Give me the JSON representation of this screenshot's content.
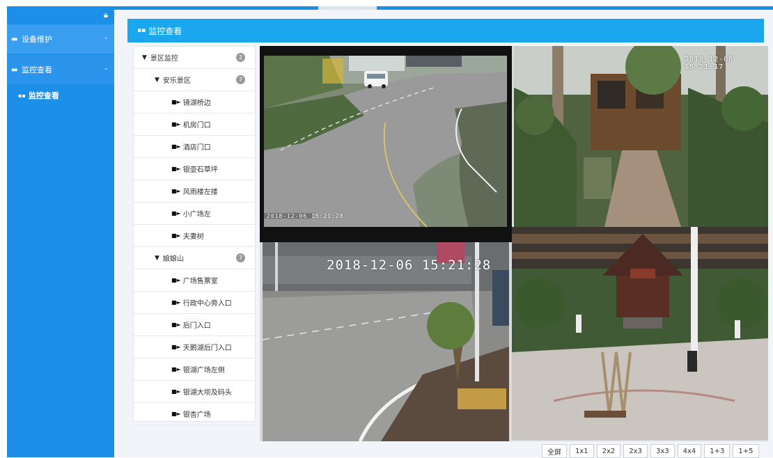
{
  "sidebar": {
    "groups": [
      {
        "label": "设备维护"
      },
      {
        "label": "监控查看"
      }
    ],
    "active_sub_label": "监控查看"
  },
  "header": {
    "title": "监控查看"
  },
  "tree": {
    "root": {
      "label": "景区监控",
      "count": "2"
    },
    "groups": [
      {
        "label": "安乐景区",
        "count": "7",
        "items": [
          "镜湖桥边",
          "机房门口",
          "酒店门口",
          "银壶石草坪",
          "风雨楼左搂",
          "小广场左",
          "夫妻树"
        ]
      },
      {
        "label": "娘娘山",
        "count": "7",
        "items": [
          "广场售票室",
          "行政中心旁入口",
          "后门入口",
          "天鹅湖后门入口",
          "银湖广场左侧",
          "银湖大坝及码头",
          "银杏广场"
        ]
      }
    ]
  },
  "video": {
    "cam1_osd_top": "2018-12-06 15:21:17",
    "cam2_osd_top": "2018-12-06 15:21:28",
    "cam3_osd": "2018-12-06 15:21:28"
  },
  "layouts": [
    "全屏",
    "1x1",
    "2x2",
    "2x3",
    "3x3",
    "4x4",
    "1+3",
    "1+5"
  ],
  "colors": {
    "primary": "#1c8fe8",
    "header": "#1aa7ee"
  }
}
